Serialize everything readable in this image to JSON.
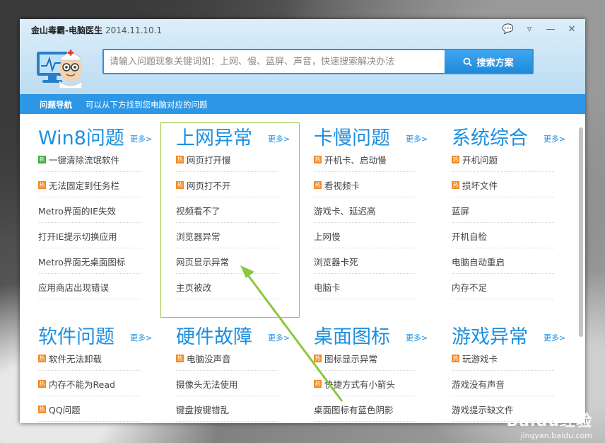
{
  "app": {
    "title": "金山毒霸-电脑医生",
    "version": "2014.11.10.1"
  },
  "search": {
    "placeholder": "请输入问题现象关键词如：上网、慢、蓝屏、声音，快速搜索解决办法",
    "button_label": "搜索方案"
  },
  "navbar": {
    "label": "问题导航",
    "description": "可以从下方找到您电脑对应的问题"
  },
  "categories": [
    {
      "title": "Win8问题",
      "more": "更多>",
      "items": [
        {
          "badge": "新",
          "label": "一键清除流氓软件"
        },
        {
          "badge": "热",
          "label": "无法固定到任务栏"
        },
        {
          "badge": "",
          "label": "Metro界面的IE失效"
        },
        {
          "badge": "",
          "label": "打开IE提示切换应用"
        },
        {
          "badge": "",
          "label": "Metro界面无桌面图标"
        },
        {
          "badge": "",
          "label": "应用商店出现错误"
        }
      ]
    },
    {
      "title": "上网异常",
      "more": "更多>",
      "items": [
        {
          "badge": "热",
          "label": "网页打开慢"
        },
        {
          "badge": "热",
          "label": "网页打不开"
        },
        {
          "badge": "",
          "label": "视频看不了"
        },
        {
          "badge": "",
          "label": "浏览器异常"
        },
        {
          "badge": "",
          "label": "网页显示异常"
        },
        {
          "badge": "",
          "label": "主页被改"
        }
      ]
    },
    {
      "title": "卡慢问题",
      "more": "更多>",
      "items": [
        {
          "badge": "热",
          "label": "开机卡、启动慢"
        },
        {
          "badge": "热",
          "label": "看视频卡"
        },
        {
          "badge": "",
          "label": "游戏卡、延迟高"
        },
        {
          "badge": "",
          "label": "上网慢"
        },
        {
          "badge": "",
          "label": "浏览器卡死"
        },
        {
          "badge": "",
          "label": "电脑卡"
        }
      ]
    },
    {
      "title": "系统综合",
      "more": "更多>",
      "items": [
        {
          "badge": "热",
          "label": "开机问题"
        },
        {
          "badge": "热",
          "label": "损坏文件"
        },
        {
          "badge": "",
          "label": "蓝屏"
        },
        {
          "badge": "",
          "label": "开机自检"
        },
        {
          "badge": "",
          "label": "电脑自动重启"
        },
        {
          "badge": "",
          "label": "内存不足"
        }
      ]
    },
    {
      "title": "软件问题",
      "more": "更多>",
      "items": [
        {
          "badge": "热",
          "label": "软件无法卸载"
        },
        {
          "badge": "热",
          "label": "内存不能为Read"
        },
        {
          "badge": "热",
          "label": "QQ问题"
        }
      ]
    },
    {
      "title": "硬件故障",
      "more": "更多>",
      "items": [
        {
          "badge": "热",
          "label": "电脑没声音"
        },
        {
          "badge": "",
          "label": "摄像头无法使用"
        },
        {
          "badge": "",
          "label": "键盘按键错乱"
        }
      ]
    },
    {
      "title": "桌面图标",
      "more": "更多>",
      "items": [
        {
          "badge": "热",
          "label": "图标显示异常"
        },
        {
          "badge": "热",
          "label": "快捷方式有小箭头"
        },
        {
          "badge": "",
          "label": "桌面图标有蓝色阴影"
        }
      ]
    },
    {
      "title": "游戏异常",
      "more": "更多>",
      "items": [
        {
          "badge": "热",
          "label": "玩游戏卡"
        },
        {
          "badge": "",
          "label": "游戏没有声音"
        },
        {
          "badge": "",
          "label": "游戏提示缺文件"
        }
      ]
    }
  ],
  "watermark": {
    "logo": "Baidu经验",
    "url": "jingyan.baidu.com"
  },
  "colors": {
    "accent": "#1e8fdf",
    "navbar": "#2e97e5",
    "hot_badge": "#f28a24",
    "new_badge": "#3cab3c",
    "highlight": "#9ec83d",
    "arrow": "#8cc63f"
  }
}
